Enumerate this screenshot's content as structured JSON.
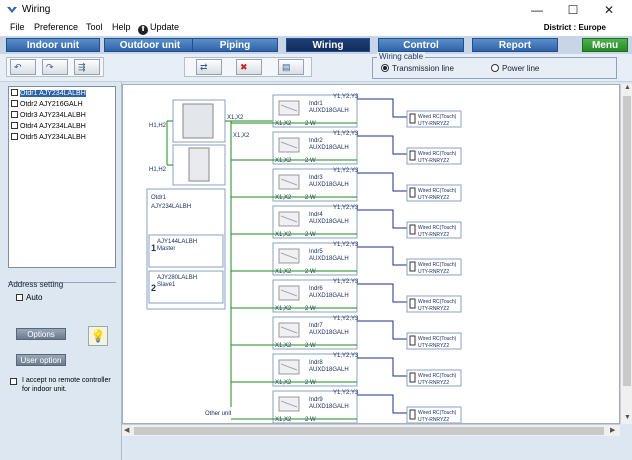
{
  "window": {
    "title": "Wiring",
    "minimize": "—",
    "maximize": "☐",
    "close": "✕"
  },
  "menu": {
    "file": "File",
    "preference": "Preference",
    "tool": "Tool",
    "help": "Help",
    "update": "Update"
  },
  "district": "District : Europe",
  "tabs": [
    {
      "label": "Indoor unit"
    },
    {
      "label": "Outdoor unit"
    },
    {
      "label": "Piping"
    },
    {
      "label": "Wiring"
    },
    {
      "label": "Control"
    },
    {
      "label": "Report"
    },
    {
      "label": "Menu"
    }
  ],
  "wiring_cable": {
    "legend": "Wiring cable",
    "options": [
      "Transmission line",
      "Power line"
    ],
    "selected": "Transmission line"
  },
  "tree": [
    {
      "label": "Otdr1 AJY234LALBH"
    },
    {
      "label": "Otdr2 AJY216GALH"
    },
    {
      "label": "Otdr3 AJY234LALBH"
    },
    {
      "label": "Otdr4 AJY234LALBH"
    },
    {
      "label": "Otdr5 AJY234LALBH"
    }
  ],
  "address_setting": {
    "title": "Address setting",
    "auto": "Auto"
  },
  "buttons": {
    "options": "Options",
    "user_option": "User option"
  },
  "accept_text": "I accept no remote controller for indoor unit.",
  "diagram": {
    "h1h2_top": "H1,H2",
    "h1h2_bottom": "H1,H2",
    "x1x2_a": "X1,X2",
    "x1x2_b": "X1,X2",
    "outdoor_name": "Otdr1",
    "outdoor_model": "AJY234LALBH",
    "master": {
      "num": "1",
      "model": "AJY144LALBH",
      "role": "Master"
    },
    "slave": {
      "num": "2",
      "model": "AJY280LALBH",
      "role": "Slave1"
    },
    "other_unit": "Other unit",
    "indoor": [
      {
        "name": "Indr1",
        "model": "AUXD18GALH",
        "top": "Y1,Y2,Y3",
        "bottom": "X1,X2",
        "wire": "2 W"
      },
      {
        "name": "Indr2",
        "model": "AUXD18GALH",
        "top": "Y1,Y2,Y3",
        "bottom": "X1,X2",
        "wire": "2 W"
      },
      {
        "name": "Indr3",
        "model": "AUXD18GALH",
        "top": "Y1,Y2,Y3",
        "bottom": "X1,X2",
        "wire": "2 W"
      },
      {
        "name": "Indr4",
        "model": "AUXD18GALH",
        "top": "Y1,Y2,Y3",
        "bottom": "X1,X2",
        "wire": "2 W"
      },
      {
        "name": "Indr5",
        "model": "AUXD18GALH",
        "top": "Y1,Y2,Y3",
        "bottom": "X1,X2",
        "wire": "2 W"
      },
      {
        "name": "Indr6",
        "model": "AUXD18GALH",
        "top": "Y1,Y2,Y3",
        "bottom": "X1,X2",
        "wire": "2 W"
      },
      {
        "name": "Indr7",
        "model": "AUXD18GALH",
        "top": "Y1,Y2,Y3",
        "bottom": "X1,X2",
        "wire": "2 W"
      },
      {
        "name": "Indr8",
        "model": "AUXD18GALH",
        "top": "Y1,Y2,Y3",
        "bottom": "X1,X2",
        "wire": "2 W"
      },
      {
        "name": "Indr9",
        "model": "AUXD18GALH",
        "top": "Y1,Y2,Y3",
        "bottom": "X1,X2",
        "wire": "2 W"
      }
    ],
    "remote": {
      "line1": "Wired RC(Touch)",
      "line2": "UTY-RNRYZ2"
    }
  },
  "colors": {
    "tab_blue": "#2f63a8",
    "tab_active": "#132c59",
    "menu_green": "#258a25",
    "wire_green": "#1e8a1e",
    "wire_blue": "#1a2f8a",
    "panel_bg": "#dde7f2"
  }
}
